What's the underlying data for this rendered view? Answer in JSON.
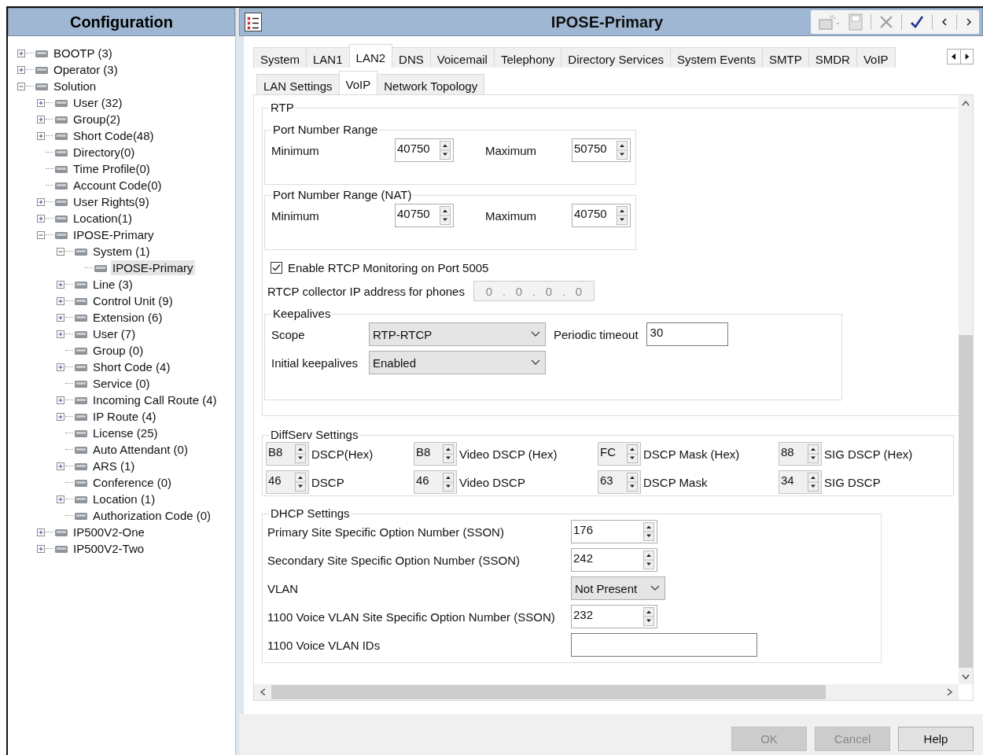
{
  "tree_panel": {
    "title": "Configuration",
    "items": [
      {
        "label": "BOOTP (3)",
        "expanded": false,
        "selected": false
      },
      {
        "label": "Operator (3)",
        "expanded": false,
        "selected": false
      },
      {
        "label": "Solution",
        "expanded": true,
        "selected": false,
        "children": [
          {
            "label": "User (32)",
            "expanded": false,
            "selected": false
          },
          {
            "label": "Group(2)",
            "expanded": false,
            "selected": false
          },
          {
            "label": "Short Code(48)",
            "expanded": false,
            "selected": false
          },
          {
            "label": "Directory(0)",
            "selected": false
          },
          {
            "label": "Time Profile(0)",
            "selected": false
          },
          {
            "label": "Account Code(0)",
            "selected": false
          },
          {
            "label": "User Rights(9)",
            "expanded": false,
            "selected": false
          },
          {
            "label": "Location(1)",
            "expanded": false,
            "selected": false
          },
          {
            "label": "IPOSE-Primary",
            "expanded": true,
            "selected": false,
            "children": [
              {
                "label": "System (1)",
                "expanded": true,
                "selected": false,
                "children": [
                  {
                    "label": "IPOSE-Primary",
                    "selected": true
                  }
                ]
              },
              {
                "label": "Line (3)",
                "expanded": false,
                "selected": false
              },
              {
                "label": "Control Unit (9)",
                "expanded": false,
                "selected": false
              },
              {
                "label": "Extension (6)",
                "expanded": false,
                "selected": false
              },
              {
                "label": "User (7)",
                "expanded": false,
                "selected": false
              },
              {
                "label": "Group (0)",
                "selected": false
              },
              {
                "label": "Short Code (4)",
                "expanded": false,
                "selected": false
              },
              {
                "label": "Service (0)",
                "selected": false
              },
              {
                "label": "Incoming Call Route (4)",
                "expanded": false,
                "selected": false
              },
              {
                "label": "IP Route (4)",
                "expanded": false,
                "selected": false
              },
              {
                "label": "License (25)",
                "selected": false
              },
              {
                "label": "Auto Attendant (0)",
                "selected": false
              },
              {
                "label": "ARS (1)",
                "expanded": false,
                "selected": false
              },
              {
                "label": "Conference (0)",
                "selected": false
              },
              {
                "label": "Location (1)",
                "expanded": false,
                "selected": false
              },
              {
                "label": "Authorization Code (0)",
                "selected": false
              }
            ]
          },
          {
            "label": "IP500V2-One",
            "expanded": false,
            "selected": false
          },
          {
            "label": "IP500V2-Two",
            "expanded": false,
            "selected": false
          }
        ]
      }
    ]
  },
  "editor": {
    "title": "IPOSE-Primary",
    "tabs": [
      {
        "label": "System",
        "selected": false
      },
      {
        "label": "LAN1",
        "selected": false
      },
      {
        "label": "LAN2",
        "selected": true
      },
      {
        "label": "DNS",
        "selected": false
      },
      {
        "label": "Voicemail",
        "selected": false
      },
      {
        "label": "Telephony",
        "selected": false
      },
      {
        "label": "Directory Services",
        "selected": false
      },
      {
        "label": "System Events",
        "selected": false
      },
      {
        "label": "SMTP",
        "selected": false
      },
      {
        "label": "SMDR",
        "selected": false
      },
      {
        "label": "VoIP",
        "selected": false
      }
    ],
    "subtabs": [
      {
        "label": "LAN Settings",
        "selected": false
      },
      {
        "label": "VoIP",
        "selected": true
      },
      {
        "label": "Network Topology",
        "selected": false
      }
    ],
    "rtp": {
      "label": "RTP",
      "ranges": [
        {
          "label": "Port Number Range",
          "fields": [
            {
              "label": "Minimum",
              "value": "40750"
            },
            {
              "label": "Maximum",
              "value": "50750"
            }
          ]
        },
        {
          "label": "Port Number Range (NAT)",
          "fields": [
            {
              "label": "Minimum",
              "value": "40750"
            },
            {
              "label": "Maximum",
              "value": "40750"
            }
          ]
        }
      ],
      "rtcp_monitoring": {
        "label": "Enable RTCP Monitoring on Port 5005",
        "checked": true
      },
      "collector": {
        "label": "RTCP collector IP address for phones",
        "octets": [
          "0",
          "0",
          "0",
          "0"
        ],
        "separator": ".",
        "disabled": true
      },
      "keepalives": {
        "label": "Keepalives",
        "scope": {
          "label": "Scope",
          "value": "RTP-RTCP"
        },
        "periodic_timeout": {
          "label": "Periodic timeout",
          "value": "30"
        },
        "initial": {
          "label": "Initial keepalives",
          "value": "Enabled"
        }
      }
    },
    "diffserv": {
      "label": "DiffServ Settings",
      "fields": [
        {
          "value": "B8",
          "label": "DSCP(Hex)"
        },
        {
          "value": "B8",
          "label": "Video DSCP (Hex)"
        },
        {
          "value": "FC",
          "label": "DSCP Mask (Hex)"
        },
        {
          "value": "88",
          "label": "SIG DSCP (Hex)"
        },
        {
          "value": "46",
          "label": "DSCP"
        },
        {
          "value": "46",
          "label": "Video DSCP"
        },
        {
          "value": "63",
          "label": "DSCP Mask"
        },
        {
          "value": "34",
          "label": "SIG DSCP"
        }
      ]
    },
    "dhcp": {
      "label": "DHCP Settings",
      "rows": [
        {
          "kind": "spin",
          "label": "Primary Site Specific Option Number (SSON)",
          "value": "176"
        },
        {
          "kind": "spin",
          "label": "Secondary Site Specific Option Number (SSON)",
          "value": "242"
        },
        {
          "kind": "dropdown",
          "label": "VLAN",
          "value": "Not Present"
        },
        {
          "kind": "spin",
          "label": "1100 Voice VLAN Site Specific Option Number (SSON)",
          "value": "232"
        },
        {
          "kind": "text",
          "label": "1100 Voice VLAN IDs"
        }
      ]
    },
    "buttons": [
      {
        "label": "OK",
        "disabled": true
      },
      {
        "label": "Cancel",
        "disabled": true
      },
      {
        "label": "Help",
        "disabled": false
      }
    ]
  }
}
